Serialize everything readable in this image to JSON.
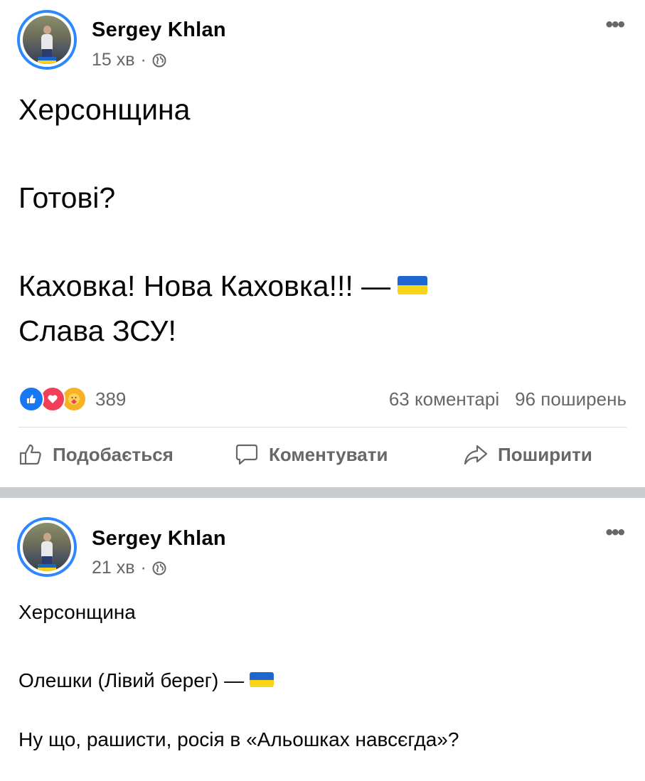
{
  "posts": [
    {
      "author": "Sergey  Khlan",
      "time": "15 хв",
      "separator": "·",
      "more_icon": "more-horizontal-icon",
      "lines": [
        "Херсонщина",
        "Готові?",
        "Каховка! Нова Каховка!!! —",
        "Слава ЗСУ!"
      ],
      "reaction_count": "389",
      "comments": "63 коментарі",
      "shares": "96 поширень",
      "actions": {
        "like": "Подобається",
        "comment": "Коментувати",
        "share": "Поширити"
      }
    },
    {
      "author": "Sergey  Khlan",
      "time": "21 хв",
      "separator": "·",
      "more_icon": "more-horizontal-icon",
      "lines": [
        "Херсонщина",
        "Олешки (Лівий берег) —",
        "Ну що, рашисти, росія в «Альошках навсєгда»?"
      ]
    }
  ],
  "colors": {
    "accent": "#1877f2",
    "secondary_text": "#65676b",
    "divider": "#c9ccd1",
    "flag_blue": "#1f66d1",
    "flag_yellow": "#f7d417"
  }
}
